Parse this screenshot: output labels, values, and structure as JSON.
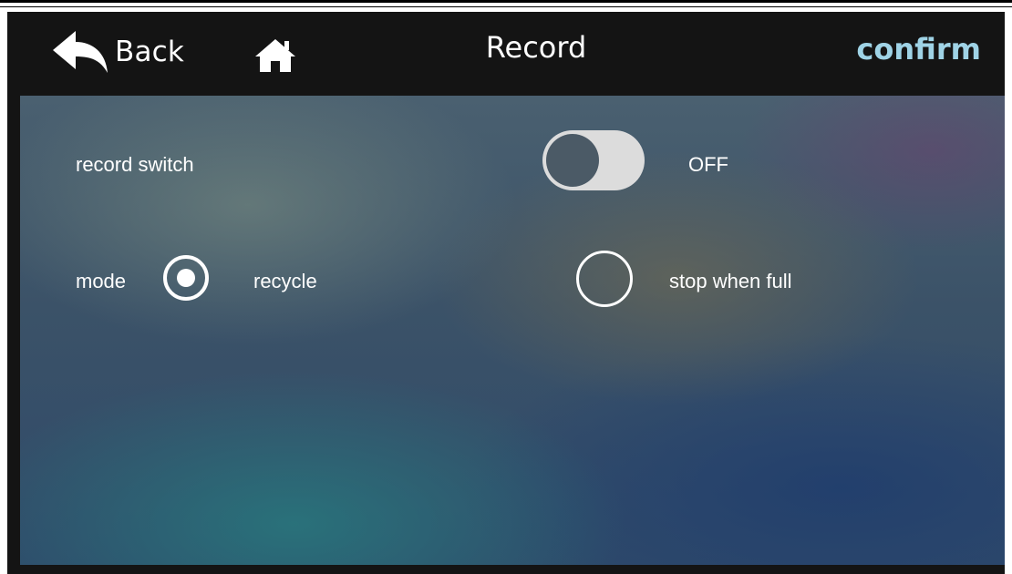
{
  "header": {
    "back_label": "Back",
    "back_icon": "reply-arrow-icon",
    "home_icon": "home-icon",
    "title": "Record",
    "confirm_label": "confirm",
    "confirm_color": "#9fd3e6"
  },
  "settings": {
    "record_switch": {
      "label": "record switch",
      "state_text": "OFF",
      "on": false
    },
    "mode": {
      "label": "mode",
      "options": [
        {
          "label": "recycle",
          "selected": true
        },
        {
          "label": "stop when full",
          "selected": false
        }
      ]
    }
  }
}
